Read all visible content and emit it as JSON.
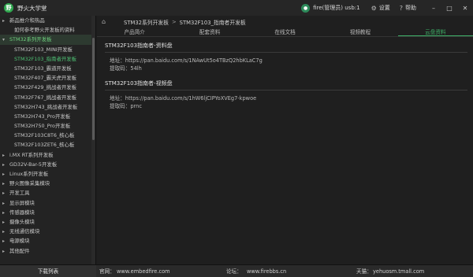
{
  "app": {
    "title": "野火大学堂",
    "logo_glyph": "野"
  },
  "header": {
    "user_name": "fire(管理员) usb:1",
    "settings_label": "设置",
    "help_label": "帮助",
    "minimize": "–",
    "maximize": "□",
    "close": "✕"
  },
  "sidebar": {
    "items": [
      {
        "label": "新品推介和热品",
        "level": 0,
        "caret": "▸"
      },
      {
        "label": "如何参考野火开发板的资料",
        "level": 1,
        "caret": ""
      },
      {
        "label": "STM32系列开发板",
        "level": 0,
        "caret": "▾"
      },
      {
        "label": "STM32F103_MINI开发板",
        "level": 1,
        "caret": ""
      },
      {
        "label": "STM32F103_指南者开发板",
        "level": 1,
        "caret": ""
      },
      {
        "label": "STM32F103_霸道开发板",
        "level": 1,
        "caret": ""
      },
      {
        "label": "STM32F407_霸天虎开发板",
        "level": 1,
        "caret": ""
      },
      {
        "label": "STM32F429_挑战者开发板",
        "level": 1,
        "caret": ""
      },
      {
        "label": "STM32F767_挑战者开发板",
        "level": 1,
        "caret": ""
      },
      {
        "label": "STM32H743_挑战者开发板",
        "level": 1,
        "caret": ""
      },
      {
        "label": "STM32H743_Pro开发板",
        "level": 1,
        "caret": ""
      },
      {
        "label": "STM32H750_Pro开发板",
        "level": 1,
        "caret": ""
      },
      {
        "label": "STM32F103C8T6_核心板",
        "level": 1,
        "caret": ""
      },
      {
        "label": "STM32F103ZET6_核心板",
        "level": 1,
        "caret": ""
      },
      {
        "label": "i.MX RT系列开发板",
        "level": 0,
        "caret": "▸"
      },
      {
        "label": "GD32V-Bar-5开发板",
        "level": 0,
        "caret": "▸"
      },
      {
        "label": "Linux系列开发板",
        "level": 0,
        "caret": "▸"
      },
      {
        "label": "野火图像采集模块",
        "level": 0,
        "caret": "▸"
      },
      {
        "label": "开发工具",
        "level": 0,
        "caret": "▸"
      },
      {
        "label": "显示屏模块",
        "level": 0,
        "caret": "▸"
      },
      {
        "label": "传感器模块",
        "level": 0,
        "caret": "▸"
      },
      {
        "label": "摄像头模块",
        "level": 0,
        "caret": "▸"
      },
      {
        "label": "无线通信模块",
        "level": 0,
        "caret": "▸"
      },
      {
        "label": "电源模块",
        "level": 0,
        "caret": "▸"
      },
      {
        "label": "其他配件",
        "level": 0,
        "caret": "▸"
      }
    ],
    "selected_index": 4,
    "selected_parent_index": 2
  },
  "breadcrumb": {
    "home_icon": "⌂",
    "parts": [
      "STM32系列开发板",
      "STM32F103_指南者开发板"
    ],
    "separator": ">"
  },
  "tabs": [
    {
      "label": "产品简介",
      "active": false
    },
    {
      "label": "配套资料",
      "active": false
    },
    {
      "label": "在线文档",
      "active": false
    },
    {
      "label": "视频教程",
      "active": false
    },
    {
      "label": "云盘资料",
      "active": true
    }
  ],
  "sections": [
    {
      "title": "STM32F103指南者-资料盘",
      "rows": [
        {
          "key": "地址：",
          "value": "https://pan.baidu.com/s/1NAwUt5o4TBzQ2hbKLaC7g"
        },
        {
          "key": "提取码：",
          "value": "54lh"
        }
      ]
    },
    {
      "title": "STM32F103指南者-视频盘",
      "rows": [
        {
          "key": "地址：",
          "value": "https://pan.baidu.com/s/1hW6ljCIPYoXVEg7-kpwoe"
        },
        {
          "key": "提取码：",
          "value": "prnc"
        }
      ]
    }
  ],
  "statusbar": {
    "download_button": "下载列表",
    "site_label": "官网：",
    "site_value": "www.embedfire.com",
    "forum_label": "论坛：",
    "forum_value": "www.firebbs.cn",
    "mall_label": "天猫：",
    "mall_value": "yehuosm.tmall.com"
  }
}
